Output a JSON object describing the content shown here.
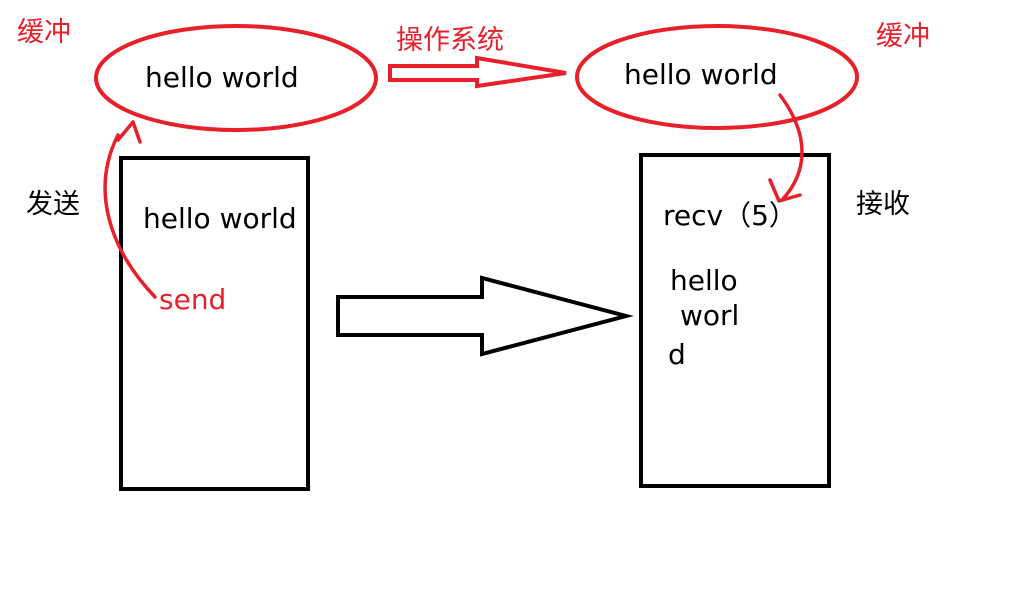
{
  "labels": {
    "buffer_left": "缓冲",
    "buffer_right": "缓冲",
    "os": "操作系统",
    "send_side": "发送",
    "recv_side": "接收"
  },
  "left_buffer_text": "hello world",
  "right_buffer_text": "hello world",
  "sender_box": {
    "content": "hello world",
    "call": "send"
  },
  "receiver_box": {
    "call": "recv（5）",
    "output_lines": [
      "hello",
      "worl",
      "d"
    ]
  },
  "colors": {
    "annotation": "#e8202a",
    "ink": "#000000"
  }
}
